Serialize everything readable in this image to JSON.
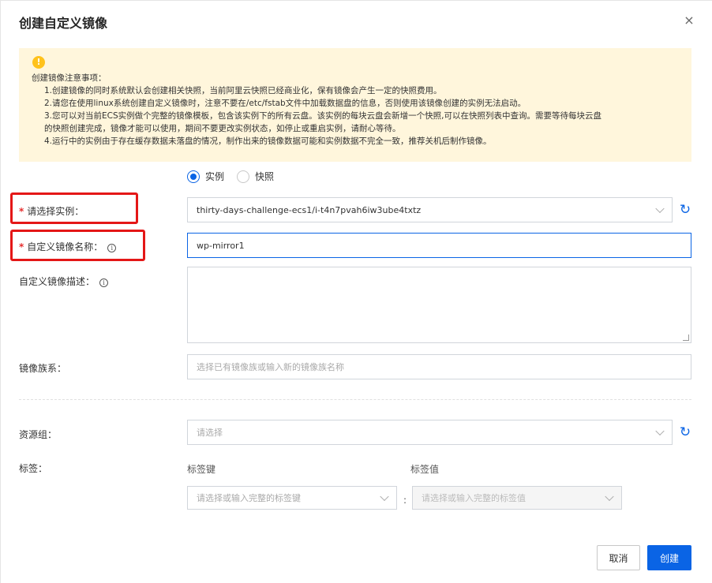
{
  "dialog": {
    "title": "创建自定义镜像",
    "close_label": "×"
  },
  "notice": {
    "icon": "warning-icon",
    "heading": "创建镜像注意事项：",
    "items": [
      "1.创建镜像的同时系统默认会创建相关快照，当前阿里云快照已经商业化，保有镜像会产生一定的快照费用。",
      "2.请您在使用linux系统创建自定义镜像时，注意不要在/etc/fstab文件中加载数据盘的信息，否则使用该镜像创建的实例无法启动。",
      "3.您可以对当前ECS实例做个完整的镜像模板，包含该实例下的所有云盘。该实例的每块云盘会新增一个快照,可以在快照列表中查询。需要等待每块云盘",
      "的快照创建完成，镜像才能可以使用，期间不要更改实例状态，如停止或重启实例，请耐心等待。",
      "4.运行中的实例由于存在缓存数据未落盘的情况，制作出来的镜像数据可能和实例数据不完全一致，推荐关机后制作镜像。"
    ]
  },
  "source": {
    "options": [
      {
        "label": "实例",
        "selected": true
      },
      {
        "label": "快照",
        "selected": false
      }
    ]
  },
  "form": {
    "required_mark": "*",
    "instance": {
      "label": "请选择实例：",
      "value": "thirty-days-challenge-ecs1/i-t4n7pvah6iw3ube4txtz"
    },
    "image_name": {
      "label": "自定义镜像名称：",
      "value": "wp-mirror1"
    },
    "description": {
      "label": "自定义镜像描述：",
      "value": ""
    },
    "family": {
      "label": "镜像族系：",
      "placeholder": "选择已有镜像族或输入新的镜像族名称"
    },
    "resource_group": {
      "label": "资源组：",
      "placeholder": "请选择"
    },
    "tags": {
      "label": "标签：",
      "key_header": "标签键",
      "value_header": "标签值",
      "key_placeholder": "请选择或输入完整的标签键",
      "value_placeholder": "请选择或输入完整的标签值",
      "separator": ":"
    },
    "info_glyph": "i"
  },
  "footer": {
    "cancel_label": "取消",
    "create_label": "创建"
  },
  "colors": {
    "primary": "#0a64e5",
    "highlight_box": "#e41717",
    "notice_bg": "#fff6dc",
    "warning": "#ffc21c"
  }
}
